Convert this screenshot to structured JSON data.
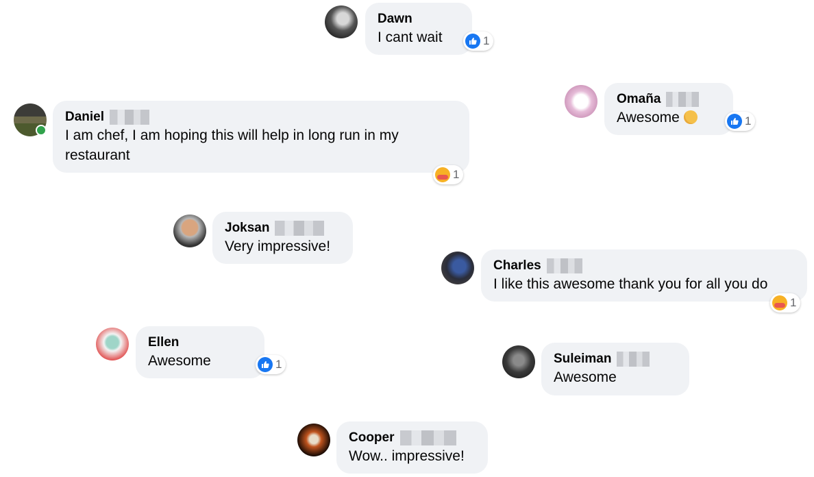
{
  "comments": [
    {
      "name": "Dawn",
      "text": "I cant wait",
      "reaction": {
        "type": "like-icon",
        "count": "1"
      }
    },
    {
      "name": "Omaña",
      "text": "Awesome",
      "emoji": "clapping-hands-icon",
      "reaction": {
        "type": "like-icon",
        "count": "1"
      }
    },
    {
      "name": "Daniel",
      "text": "I am chef, I am hoping this will help in long run in my restaurant",
      "reaction": {
        "type": "care-icon",
        "count": "1"
      }
    },
    {
      "name": "Joksan",
      "text": "Very impressive!"
    },
    {
      "name": "Charles",
      "text": "I like this awesome thank you for all you do",
      "reaction": {
        "type": "care-icon",
        "count": "1"
      }
    },
    {
      "name": "Ellen",
      "text": "Awesome",
      "reaction": {
        "type": "like-icon",
        "count": "1"
      }
    },
    {
      "name": "Suleiman",
      "text": "Awesome"
    },
    {
      "name": "Cooper",
      "text": "Wow.. impressive!"
    }
  ],
  "colors": {
    "bubble": "#f0f2f5",
    "like": "#1877f2",
    "care": "#f7b125",
    "online": "#31a24c"
  }
}
